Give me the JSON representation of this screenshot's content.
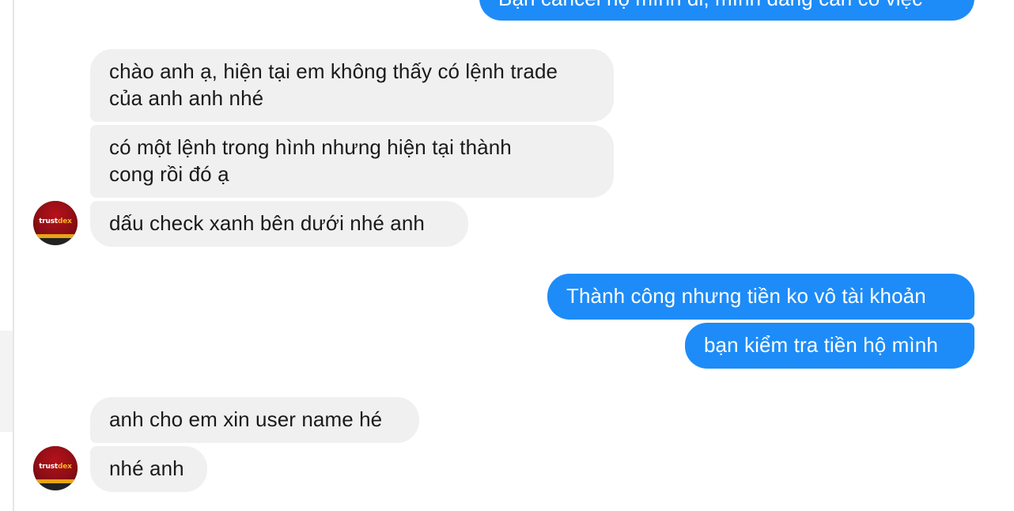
{
  "conversation": {
    "messages": [
      {
        "id": "m0",
        "side": "out",
        "lines": [
          "Bạn cancel hộ mình đi, mình đang cần có việc"
        ]
      },
      {
        "id": "m1",
        "side": "in",
        "lines": [
          "chào anh ạ, hiện tại em không thấy có lệnh trade",
          "của anh anh nhé"
        ]
      },
      {
        "id": "m2",
        "side": "in",
        "lines": [
          "có một lệnh trong hình nhưng hiện tại thành",
          "cong rồi đó ạ"
        ]
      },
      {
        "id": "m3",
        "side": "in",
        "lines": [
          "dấu check xanh bên dưới nhé anh"
        ]
      },
      {
        "id": "m4",
        "side": "out",
        "lines": [
          "Thành công nhưng tiền ko vô tài khoản"
        ]
      },
      {
        "id": "m5",
        "side": "out",
        "lines": [
          "bạn kiểm tra tiền hộ mình"
        ]
      },
      {
        "id": "m6",
        "side": "in",
        "lines": [
          "anh cho em xin user name hé"
        ]
      },
      {
        "id": "m7",
        "side": "in",
        "lines": [
          "nhé anh"
        ]
      }
    ]
  },
  "contact": {
    "avatar_logo_text_a": "trust",
    "avatar_logo_text_b": "dex"
  },
  "colors": {
    "outgoing_bubble": "#1d8cf8",
    "incoming_bubble": "#f0f0f0",
    "avatar_red": "#b5121b",
    "avatar_gold": "#e8a317"
  }
}
